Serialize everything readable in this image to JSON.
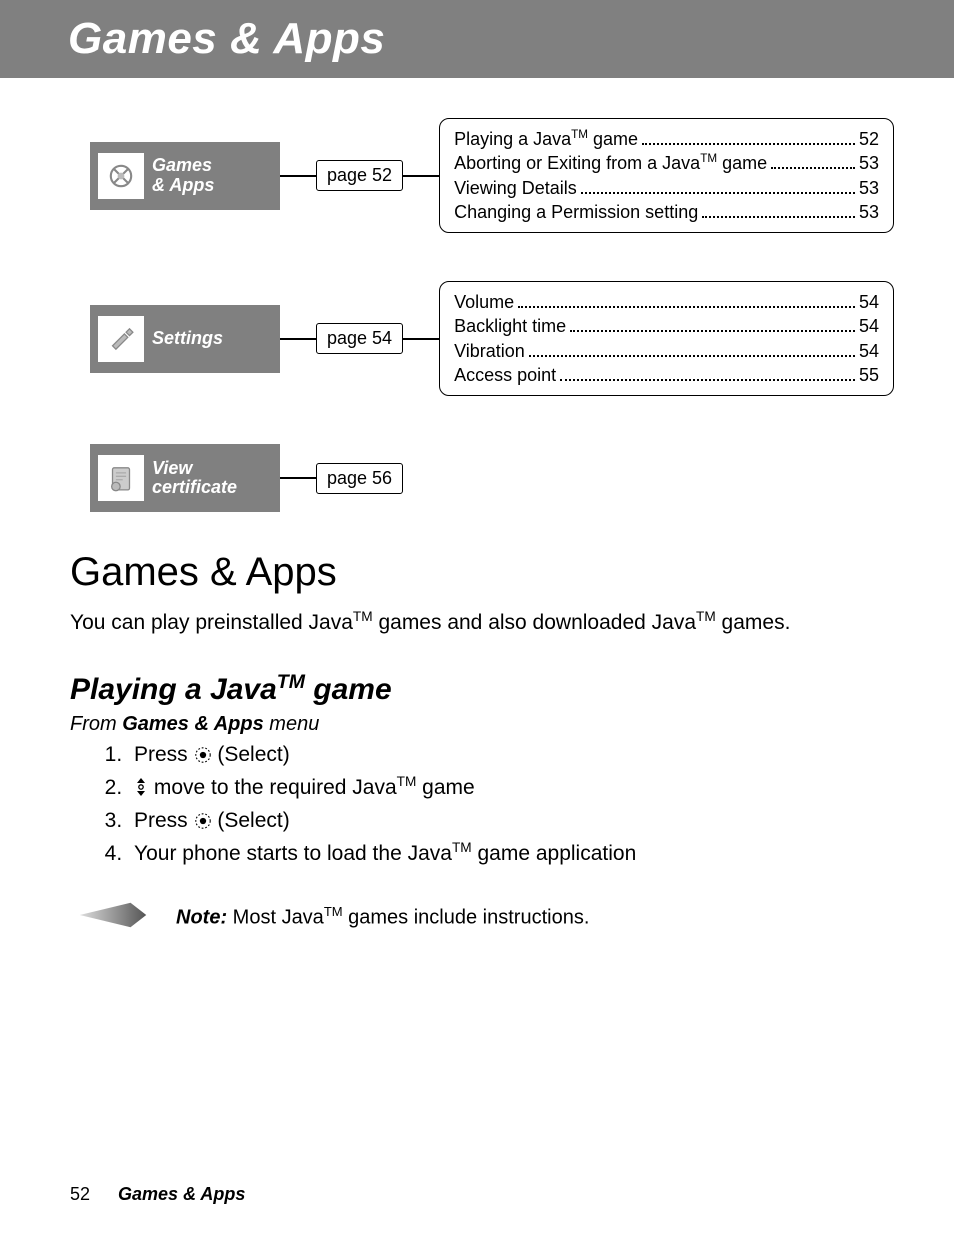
{
  "banner": {
    "title": "Games & Apps"
  },
  "nav": [
    {
      "label": "Games\n& Apps",
      "pageBadge": "page 52",
      "toc": [
        {
          "label": "Playing a Java",
          "sup": "TM",
          "label2": " game",
          "page": "52"
        },
        {
          "label": "Aborting or Exiting from a Java",
          "sup": "TM",
          "label2": " game",
          "page": "53"
        },
        {
          "label": "Viewing Details",
          "sup": "",
          "label2": "",
          "page": "53"
        },
        {
          "label": "Changing a Permission setting",
          "sup": "",
          "label2": "",
          "page": "53"
        }
      ]
    },
    {
      "label": "Settings",
      "pageBadge": "page 54",
      "toc": [
        {
          "label": "Volume",
          "sup": "",
          "label2": "",
          "page": "54"
        },
        {
          "label": "Backlight time",
          "sup": "",
          "label2": "",
          "page": "54"
        },
        {
          "label": "Vibration",
          "sup": "",
          "label2": "",
          "page": "54"
        },
        {
          "label": "Access point",
          "sup": "",
          "label2": "",
          "page": "55"
        }
      ]
    },
    {
      "label": "View\ncertificate",
      "pageBadge": "page 56",
      "toc": null
    }
  ],
  "section": {
    "heading": "Games & Apps",
    "intro_a": "You can play preinstalled Java",
    "intro_sup": "TM",
    "intro_b": " games and also downloaded Java",
    "intro_sup2": "TM",
    "intro_c": " games."
  },
  "sub": {
    "heading_a": "Playing a Java",
    "heading_sup": "TM",
    "heading_b": " game",
    "from_a": "From ",
    "from_b": "Games & Apps",
    "from_c": " menu"
  },
  "steps": {
    "s1a": "Press ",
    "s1b": " (Select)",
    "s2a": "",
    "s2b": " move to the required Java",
    "s2sup": "TM",
    "s2c": " game",
    "s3a": "Press ",
    "s3b": " (Select)",
    "s4a": "Your phone starts to load the Java",
    "s4sup": "TM",
    "s4b": " game application"
  },
  "note": {
    "label": "Note:",
    "text_a": " Most Java",
    "sup": "TM",
    "text_b": " games include instructions."
  },
  "footer": {
    "page": "52",
    "title": "Games & Apps"
  }
}
